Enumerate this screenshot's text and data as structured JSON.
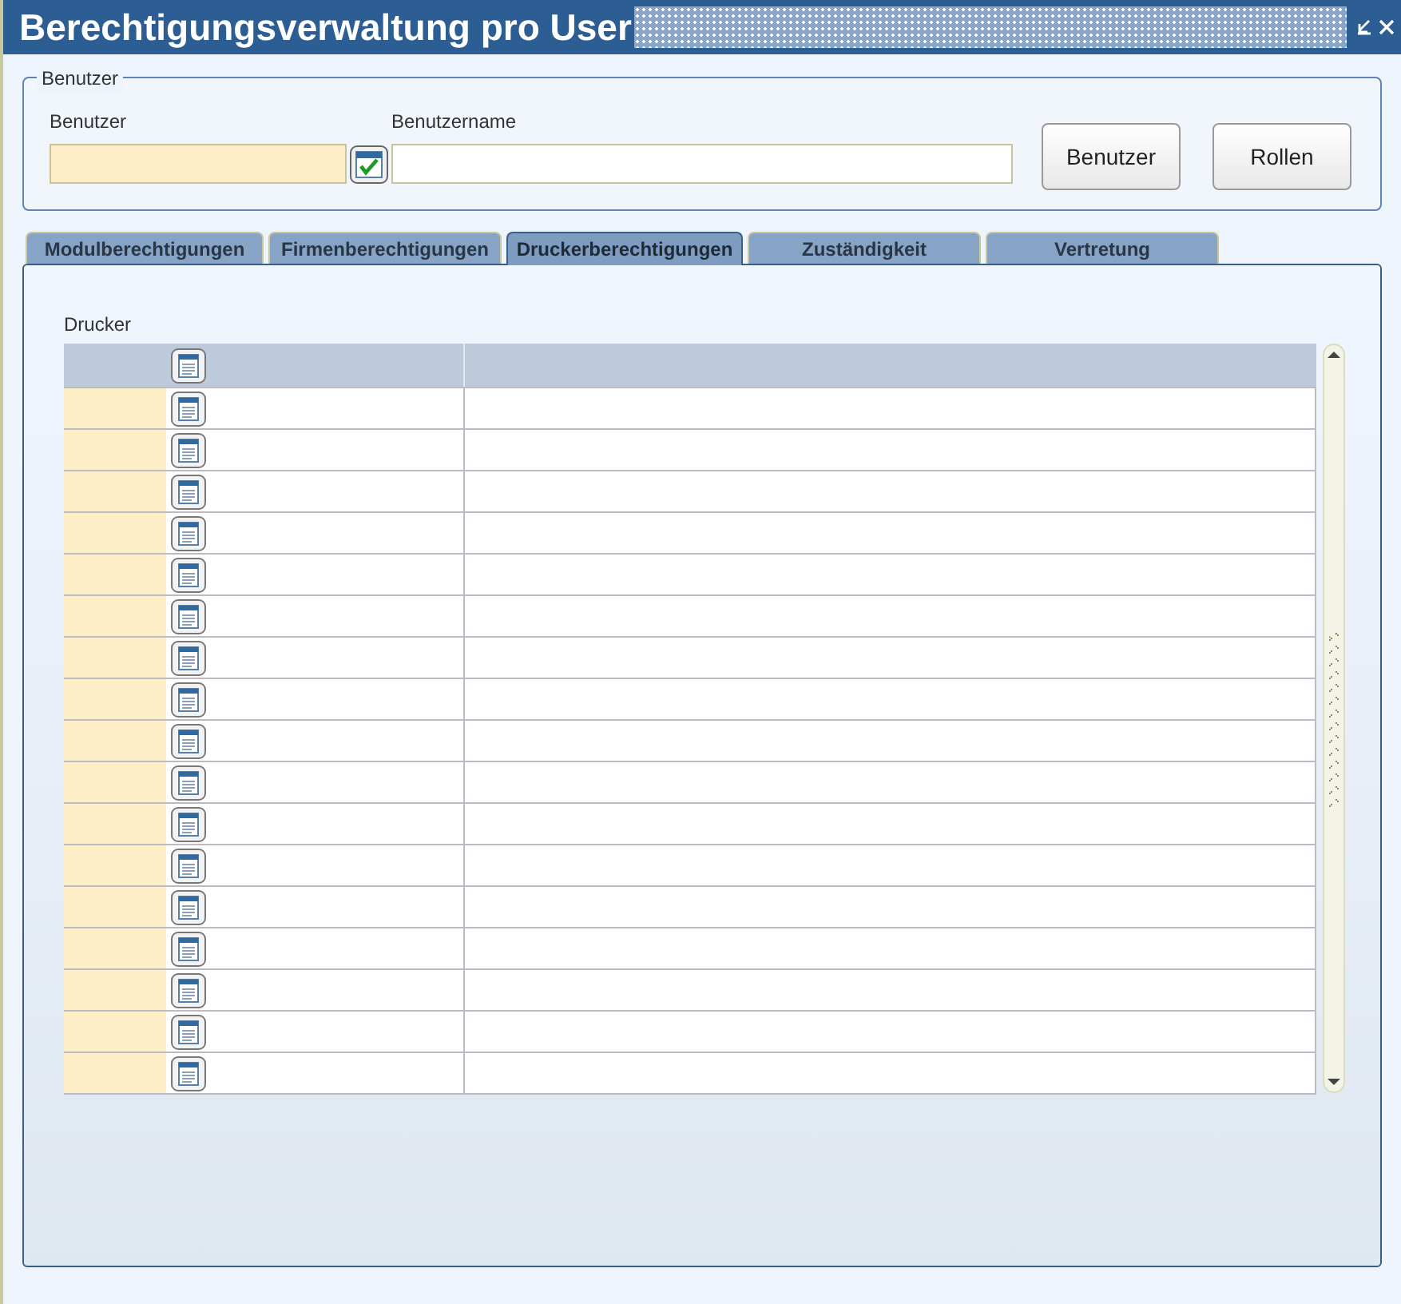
{
  "window": {
    "title": "Berechtigungsverwaltung pro User"
  },
  "user_group": {
    "legend": "Benutzer",
    "fields": [
      {
        "label": "Benutzer",
        "kind": "required"
      },
      {
        "label": "Benutzername",
        "kind": "plain"
      }
    ],
    "buttons": [
      "Benutzer",
      "Rollen"
    ]
  },
  "tabs": [
    {
      "label": "Modulberechtigungen",
      "selected": false
    },
    {
      "label": "Firmenberechtigungen",
      "selected": false
    },
    {
      "label": "Druckerberechtigungen",
      "selected": true
    },
    {
      "label": "Zuständigkeit",
      "selected": false
    },
    {
      "label": "Vertretung",
      "selected": false
    }
  ],
  "grid": {
    "label": "Drucker",
    "rows": [
      {
        "kind": "header"
      },
      {
        "kind": "blank"
      },
      {
        "kind": "blank"
      },
      {
        "kind": "blank"
      },
      {
        "kind": "blank"
      },
      {
        "kind": "blank"
      },
      {
        "kind": "blank"
      },
      {
        "kind": "blank"
      },
      {
        "kind": "blank"
      },
      {
        "kind": "blank"
      },
      {
        "kind": "blank"
      },
      {
        "kind": "blank"
      },
      {
        "kind": "blank"
      },
      {
        "kind": "blank"
      },
      {
        "kind": "blank"
      },
      {
        "kind": "blank"
      },
      {
        "kind": "blank"
      },
      {
        "kind": "blank"
      }
    ]
  }
}
